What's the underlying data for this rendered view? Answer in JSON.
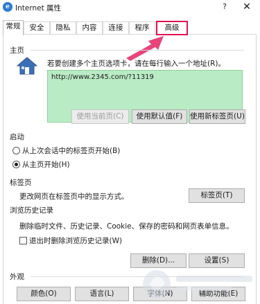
{
  "window": {
    "title": "Internet 属性",
    "help_glyph": "?",
    "close_glyph": "✕"
  },
  "tabs": [
    {
      "label": "常规",
      "active": true
    },
    {
      "label": "安全"
    },
    {
      "label": "隐私"
    },
    {
      "label": "内容"
    },
    {
      "label": "连接"
    },
    {
      "label": "程序"
    },
    {
      "label": "高级",
      "highlighted": true
    }
  ],
  "homepage": {
    "section_title": "主页",
    "instruction": "若要创建多个主页选项卡，请在每行输入一个地址(R)。",
    "url_value": "http://www.2345.com/?11319",
    "buttons": {
      "use_current": "使用当前页(C)",
      "use_default": "使用默认值(F)",
      "use_new_tab": "使用新标签页(U)"
    }
  },
  "startup": {
    "section_title": "启动",
    "option_last_session": "从上次会话中的标签页开始(B)",
    "option_homepage": "从主页开始(H)",
    "selected": "option_homepage"
  },
  "tabs_section": {
    "section_title": "标签页",
    "description": "更改网页在标签页中的显示方式。",
    "button": "标签页(T)"
  },
  "history": {
    "section_title": "浏览历史记录",
    "description": "删除临时文件、历史记录、Cookie、保存的密码和网页表单信息。",
    "checkbox_label": "退出时删除浏览历史记录(W)",
    "checkbox_checked": false,
    "delete_button": "删除(D)...",
    "settings_button": "设置(S)"
  },
  "appearance": {
    "section_title": "外观",
    "colors_button": "颜色(O)",
    "languages_button": "语言(L)",
    "fonts_button": "字体(N)",
    "accessibility_button": "辅助功能(E)"
  },
  "colors": {
    "url_box_bg": "#b9ebc4",
    "highlight": "#e0124f",
    "arrow": "#e8457a"
  },
  "icons": {
    "app": "internet-options-icon",
    "home": "house-icon",
    "arrow": "pink-arrow-annotation"
  }
}
